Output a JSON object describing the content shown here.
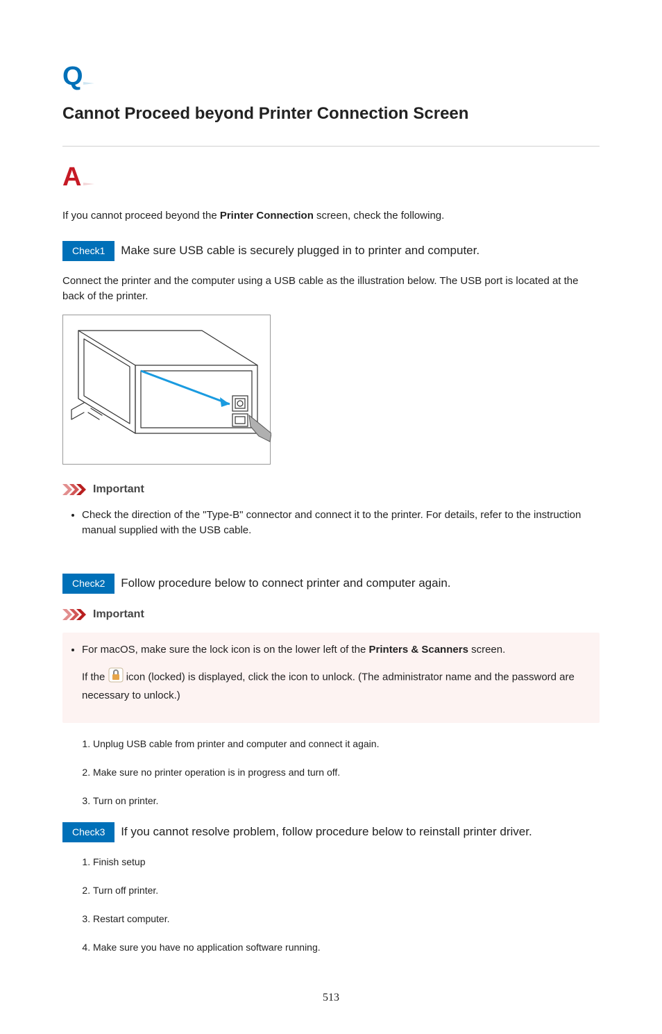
{
  "page": {
    "title": "Cannot Proceed beyond Printer Connection Screen",
    "intro_before": "If you cannot proceed beyond the ",
    "intro_bold": "Printer Connection",
    "intro_after": " screen, check the following.",
    "page_number": "513"
  },
  "check1": {
    "label": "Check1",
    "text": "Make sure USB cable is securely plugged in to printer and computer.",
    "body": "Connect the printer and the computer using a USB cable as the illustration below. The USB port is located at the back of the printer."
  },
  "important1": {
    "heading": "Important",
    "item": "Check the direction of the \"Type-B\" connector and connect it to the printer. For details, refer to the instruction manual supplied with the USB cable."
  },
  "check2": {
    "label": "Check2",
    "text": "Follow procedure below to connect printer and computer again."
  },
  "important2": {
    "heading": "Important",
    "item_before": "For macOS, make sure the lock icon is on the lower left of the ",
    "item_bold": "Printers & Scanners",
    "item_after": " screen.",
    "lock_before": "If the ",
    "lock_after": " icon (locked) is displayed, click the icon to unlock. (The administrator name and the password are necessary to unlock.)"
  },
  "steps1": {
    "s1": "Unplug USB cable from printer and computer and connect it again.",
    "s2": "Make sure no printer operation is in progress and turn off.",
    "s3": "Turn on printer."
  },
  "check3": {
    "label": "Check3",
    "text": "If you cannot resolve problem, follow procedure below to reinstall printer driver."
  },
  "steps2": {
    "s1": "Finish setup",
    "s2": "Turn off printer.",
    "s3": "Restart computer.",
    "s4": "Make sure you have no application software running."
  }
}
